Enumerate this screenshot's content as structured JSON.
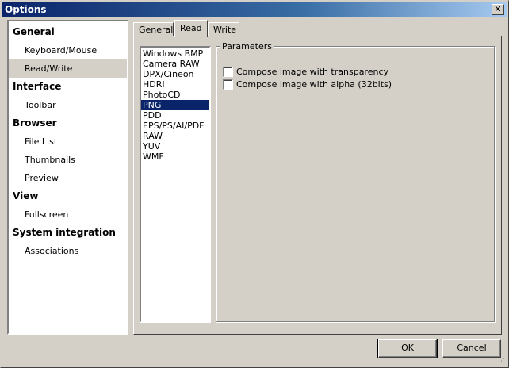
{
  "window": {
    "title": "Options",
    "close_symbol": "✕"
  },
  "categories": [
    {
      "label": "General",
      "type": "group"
    },
    {
      "label": "Keyboard/Mouse",
      "type": "sub"
    },
    {
      "label": "Read/Write",
      "type": "sub",
      "selected": true
    },
    {
      "label": "Interface",
      "type": "group"
    },
    {
      "label": "Toolbar",
      "type": "sub"
    },
    {
      "label": "Browser",
      "type": "group"
    },
    {
      "label": "File List",
      "type": "sub"
    },
    {
      "label": "Thumbnails",
      "type": "sub"
    },
    {
      "label": "Preview",
      "type": "sub"
    },
    {
      "label": "View",
      "type": "group"
    },
    {
      "label": "Fullscreen",
      "type": "sub"
    },
    {
      "label": "System integration",
      "type": "group"
    },
    {
      "label": "Associations",
      "type": "sub"
    }
  ],
  "tabs": [
    {
      "label": "General"
    },
    {
      "label": "Read",
      "active": true
    },
    {
      "label": "Write"
    }
  ],
  "formats": [
    "Windows BMP",
    "Camera RAW",
    "DPX/Cineon",
    "HDRI",
    "PhotoCD",
    "PNG",
    "PDD",
    "EPS/PS/AI/PDF",
    "RAW",
    "YUV",
    "WMF"
  ],
  "selected_format": "PNG",
  "parameters": {
    "title": "Parameters",
    "options": [
      {
        "label": "Compose image with transparency",
        "checked": false
      },
      {
        "label": "Compose image with alpha (32bits)",
        "checked": false
      }
    ]
  },
  "buttons": {
    "ok": "OK",
    "cancel": "Cancel"
  }
}
